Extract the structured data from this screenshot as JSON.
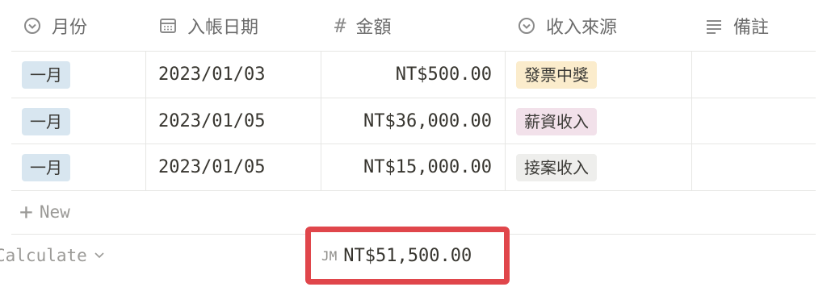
{
  "columns": [
    {
      "label": "月份",
      "icon": "select-icon"
    },
    {
      "label": "入帳日期",
      "icon": "calendar-icon"
    },
    {
      "label": "金額",
      "icon": "hash-icon"
    },
    {
      "label": "收入來源",
      "icon": "select-icon"
    },
    {
      "label": "備註",
      "icon": "text-lines-icon"
    }
  ],
  "rows": [
    {
      "month": "一月",
      "date": "2023/01/03",
      "amount": "NT$500.00",
      "source": "發票中獎",
      "source_color": "#fbeccc",
      "note": ""
    },
    {
      "month": "一月",
      "date": "2023/01/05",
      "amount": "NT$36,000.00",
      "source": "薪資收入",
      "source_color": "#f2e1ea",
      "note": ""
    },
    {
      "month": "一月",
      "date": "2023/01/05",
      "amount": "NT$15,000.00",
      "source": "接案收入",
      "source_color": "#eeeeec",
      "note": ""
    }
  ],
  "month_tag_color": "#d8e6f0",
  "new_row": {
    "label": "New"
  },
  "footer": {
    "calculate_label": "Calculate",
    "sum_label": "JM",
    "sum_value": "NT$51,500.00"
  },
  "highlight_color": "#e0464b"
}
